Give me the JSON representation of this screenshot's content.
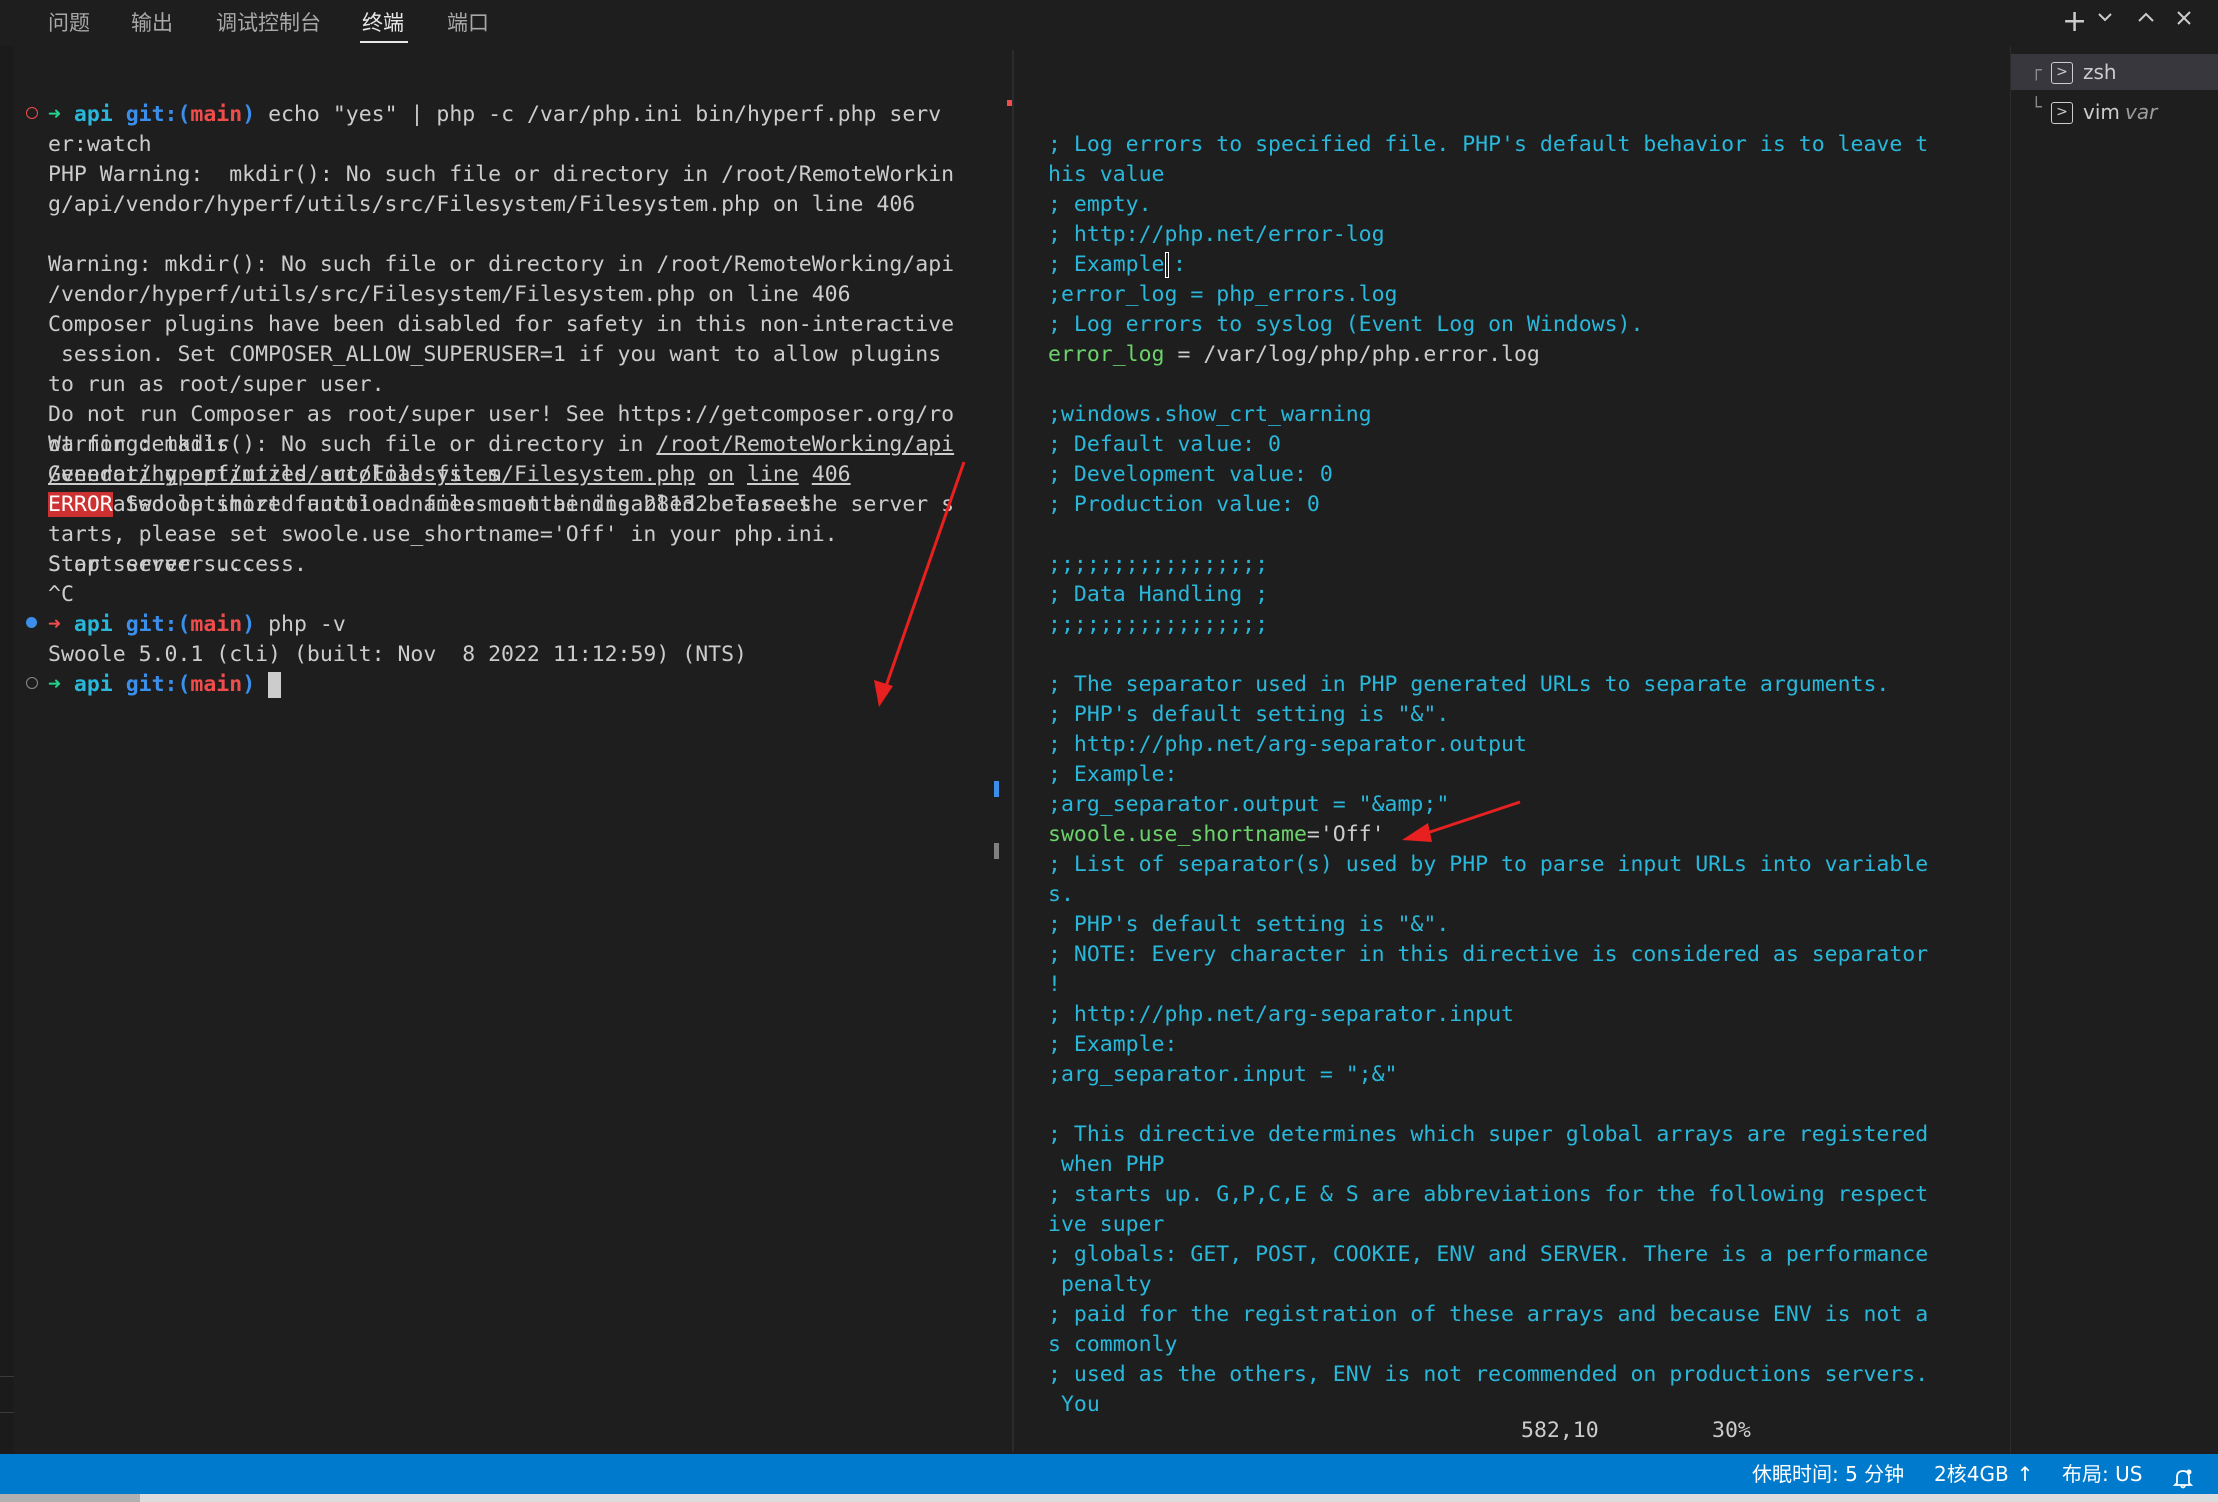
{
  "panel_tabs": [
    "问题",
    "输出",
    "调试控制台",
    "终端",
    "端口"
  ],
  "active_tab": "终端",
  "top_icons": {
    "add": "plus-icon",
    "dropdown": "chevron-down-icon",
    "maximize": "chevron-up-icon",
    "close": "close-icon"
  },
  "terminals": [
    {
      "shell": "zsh",
      "subtitle": ""
    },
    {
      "shell": "vim",
      "subtitle": "var"
    }
  ],
  "left_terminal": {
    "cmd1_cwd": "api",
    "cmd1_git": "git:(",
    "cmd1_branch": "main",
    "cmd1_git_close": ")",
    "cmd1_text": " echo \"yes\" | php -c /var/php.ini bin/hyperf.php serv",
    "lines_a": [
      "er:watch",
      "PHP Warning:  mkdir(): No such file or directory in /root/RemoteWorkin",
      "g/api/vendor/hyperf/utils/src/Filesystem/Filesystem.php on line 406",
      "",
      "Warning: mkdir(): No such file or directory in /root/RemoteWorking/api",
      "/vendor/hyperf/utils/src/Filesystem/Filesystem.php on line 406",
      "Composer plugins have been disabled for safety in this non-interactive",
      " session. Set COMPOSER_ALLOW_SUPERUSER=1 if you want to allow plugins",
      "to run as root/super user.",
      "Do not run Composer as root/super user! See https://getcomposer.org/ro",
      "ot for details",
      "Generating optimized autoload files",
      "Generated optimized autoload files containing 28132 classes",
      "",
      "Start server ...",
      ""
    ],
    "warn_prefix": "Warning: mkdir(): No such file or directory in ",
    "warn_link1": "/root/RemoteWorking/api",
    "warn_link2": "/vendor/hyperf/utils/src/Filesystem/Filesystem.php",
    "warn_on": "on",
    "warn_line": "line",
    "warn_num": "406",
    "error_badge": "ERROR",
    "error_text": " Swoole short function names must be disabled before the server s",
    "lines_b": [
      "tarts, please set swoole.use_shortname='Off' in your php.ini.",
      "Stop server success.",
      "^C"
    ],
    "cmd2_cwd": "api",
    "cmd2_git": "git:(",
    "cmd2_branch": "main",
    "cmd2_git_close": ")",
    "cmd2_text": " php -v",
    "version_line": "Swoole 5.0.1 (cli) (built: Nov  8 2022 11:12:59) (NTS)",
    "cmd3_cwd": "api",
    "cmd3_git": "git:(",
    "cmd3_branch": "main",
    "cmd3_git_close": ")"
  },
  "right_terminal": {
    "lines1": [
      "; Log errors to specified file. PHP's default behavior is to leave t",
      "his value",
      "; empty.",
      "; http://php.net/error-log"
    ],
    "example_line": "; Example",
    "example_colon": ":",
    "lines2": [
      ";error_log = php_errors.log",
      "; Log errors to syslog (Event Log on Windows)."
    ],
    "error_log_key": "error_log",
    "error_log_val": " = /var/log/php/php.error.log",
    "lines3": [
      "",
      ";windows.show_crt_warning",
      "; Default value: 0",
      "; Development value: 0",
      "; Production value: 0",
      "",
      ";;;;;;;;;;;;;;;;;",
      "; Data Handling ;",
      ";;;;;;;;;;;;;;;;;",
      "",
      "; The separator used in PHP generated URLs to separate arguments.",
      "; PHP's default setting is \"&\".",
      "; http://php.net/arg-separator.output",
      "; Example:",
      ";arg_separator.output = \"&amp;\""
    ],
    "swoole_key": "swoole.use_shortname",
    "swoole_val": "='Off'",
    "lines4": [
      "; List of separator(s) used by PHP to parse input URLs into variable",
      "s.",
      "; PHP's default setting is \"&\".",
      "; NOTE: Every character in this directive is considered as separator",
      "!",
      "; http://php.net/arg-separator.input",
      "; Example:",
      ";arg_separator.input = \";&\"",
      "",
      "; This directive determines which super global arrays are registered",
      " when PHP",
      "; starts up. G,P,C,E & S are abbreviations for the following respect",
      "ive super",
      "; globals: GET, POST, COOKIE, ENV and SERVER. There is a performance",
      " penalty",
      "; paid for the registration of these arrays and because ENV is not a",
      "s commonly",
      "; used as the others, ENV is not recommended on productions servers.",
      " You"
    ],
    "cursor_pos": "582,10",
    "scroll_percent": "30%"
  },
  "status_bar": {
    "sleep": "休眠时间: 5 分钟",
    "resources": "2核4GB",
    "layout": "布局: US"
  },
  "colors": {
    "status_bar": "#007acc",
    "error_badge": "#cd3131",
    "arrow_annotation": "#e8201f"
  }
}
